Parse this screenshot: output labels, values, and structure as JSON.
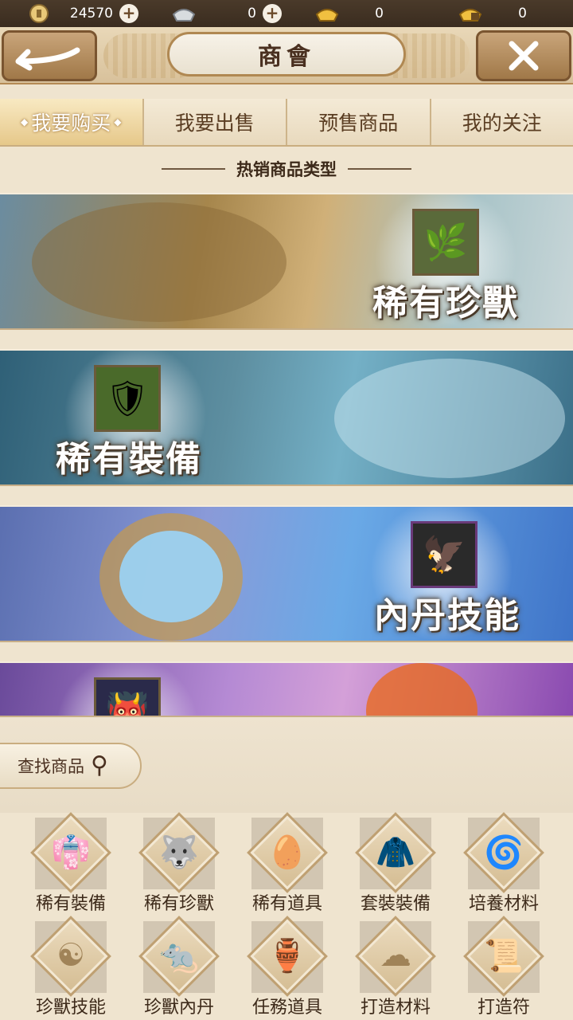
{
  "currency": [
    {
      "icon": "coin-icon",
      "value": "24570",
      "has_plus": true
    },
    {
      "icon": "silver-ingot-icon",
      "value": "0",
      "has_plus": true
    },
    {
      "icon": "gold-ingot-icon",
      "value": "0",
      "has_plus": false
    },
    {
      "icon": "locked-gold-icon",
      "value": "0",
      "has_plus": false
    }
  ],
  "header": {
    "title": "商會"
  },
  "tabs": [
    {
      "label": "我要购买",
      "active": true
    },
    {
      "label": "我要出售",
      "active": false
    },
    {
      "label": "预售商品",
      "active": false
    },
    {
      "label": "我的关注",
      "active": false
    }
  ],
  "section": {
    "title": "热销商品类型"
  },
  "banners": [
    {
      "label": "稀有珍獸",
      "item_icon": "plant-pet-icon"
    },
    {
      "label": "稀有裝備",
      "item_icon": "armor-icon"
    },
    {
      "label": "內丹技能",
      "item_icon": "eagle-icon"
    },
    {
      "label": "",
      "item_icon": "demon-icon"
    }
  ],
  "search": {
    "label": "查找商品"
  },
  "categories": [
    {
      "label": "稀有裝備",
      "icon": "robe-icon"
    },
    {
      "label": "稀有珍獸",
      "icon": "beast-icon"
    },
    {
      "label": "稀有道具",
      "icon": "egg-icon"
    },
    {
      "label": "套裝裝備",
      "icon": "suit-icon"
    },
    {
      "label": "培養材料",
      "icon": "swirl-orb-icon"
    },
    {
      "label": "珍獸技能",
      "icon": "triskele-icon"
    },
    {
      "label": "珍獸內丹",
      "icon": "rat-icon"
    },
    {
      "label": "任務道具",
      "icon": "jar-icon"
    },
    {
      "label": "打造材料",
      "icon": "cloud-icon"
    },
    {
      "label": "打造符",
      "icon": "scroll-icon"
    }
  ]
}
